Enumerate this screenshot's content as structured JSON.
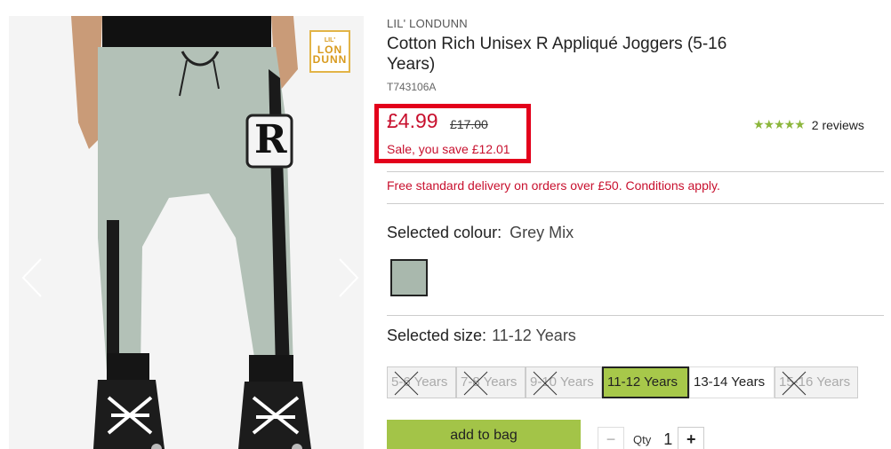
{
  "gallery": {
    "brand_logo_top": "LIL'",
    "brand_logo_line1": "LON",
    "brand_logo_line2": "DUNN",
    "patch_letter": "R"
  },
  "product": {
    "brand": "LIL' LONDUNN",
    "title": "Cotton Rich Unisex R Appliqué Joggers (5-16 Years)",
    "sku": "T743106A",
    "price": "£4.99",
    "old_price": "£17.00",
    "save_text": "Sale, you save £12.01",
    "rating_stars": 5,
    "reviews": "2 reviews",
    "delivery": "Free standard delivery on orders over £50. Conditions apply."
  },
  "colour": {
    "label": "Selected colour:",
    "value": "Grey Mix",
    "swatch_color": "#a9b8ad"
  },
  "size": {
    "label": "Selected size:",
    "value": "11-12 Years",
    "options": [
      {
        "label": "5-6 Years",
        "state": "unavailable"
      },
      {
        "label": "7-8 Years",
        "state": "unavailable"
      },
      {
        "label": "9-10 Years",
        "state": "unavailable"
      },
      {
        "label": "11-12 Years",
        "state": "selected"
      },
      {
        "label": "13-14 Years",
        "state": "available"
      },
      {
        "label": "15-16 Years",
        "state": "unavailable"
      }
    ]
  },
  "purchase": {
    "add_to_bag": "add to bag",
    "qty_label": "Qty",
    "qty_value": "1",
    "minus": "−",
    "plus": "+"
  },
  "colors": {
    "sale_red": "#c8102e",
    "highlight_red": "#e3001b",
    "accent_green": "#a3c448",
    "star_green": "#8cb63c"
  }
}
